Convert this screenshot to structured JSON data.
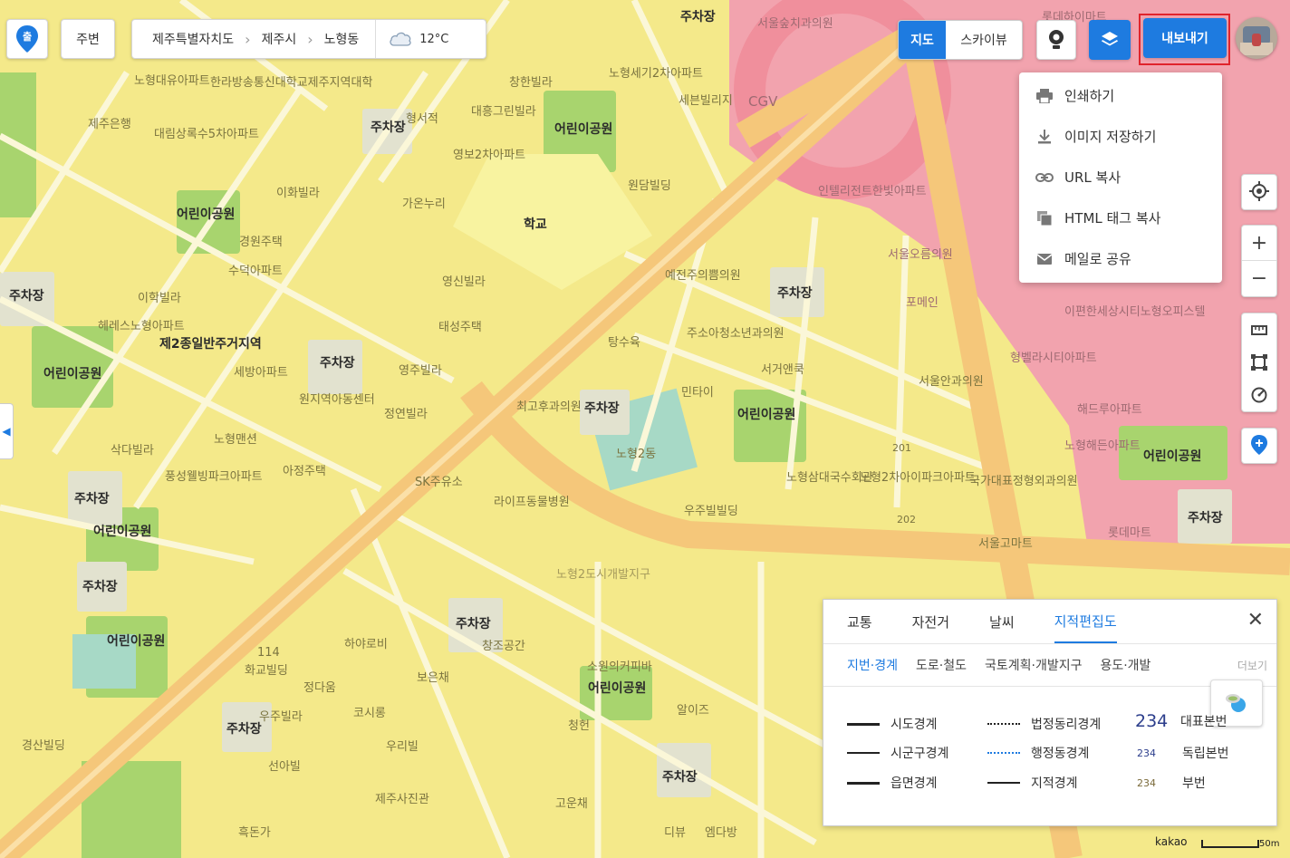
{
  "topbar": {
    "logo_icon": "kakao-map-pin-icon",
    "nearby_label": "주변",
    "breadcrumb": [
      "제주특별자치도",
      "제주시",
      "노형동"
    ],
    "weather_icon": "cloud-icon",
    "temperature": "12°C",
    "map_type": {
      "map_label": "지도",
      "skyview_label": "스카이뷰",
      "active": "지도"
    },
    "roadview_icon": "roadview-icon",
    "layers_icon": "layers-icon",
    "export_label": "내보내기",
    "avatar": "user-avatar"
  },
  "export_menu": [
    {
      "icon": "print-icon",
      "label": "인쇄하기"
    },
    {
      "icon": "download-icon",
      "label": "이미지 저장하기"
    },
    {
      "icon": "link-icon",
      "label": "URL 복사"
    },
    {
      "icon": "copy-icon",
      "label": "HTML 태그 복사"
    },
    {
      "icon": "mail-icon",
      "label": "메일로 공유"
    }
  ],
  "map_labels": {
    "parking": "주차장",
    "playground": "어린이공원",
    "school": "학교",
    "zone": "제2종일반주거지역",
    "cgv": "CGV",
    "places": [
      "노형대유아파트",
      "제주은행",
      "대림상록수5차아파트",
      "한라방송통신대학교제주지역대학",
      "창한빌라",
      "노형세기2차아파트",
      "세븐빌리지",
      "서울숲치과의원",
      "롯데하이마트",
      "인텔리전트한빛아파트",
      "원담빌딩",
      "예전주의쁨의원",
      "주소아청소년과의원",
      "서거앤쿡",
      "민타이",
      "탕수육",
      "최고후과의원",
      "서울오름의원",
      "포메인",
      "이편한세상시티노형오피스텔",
      "형벨라시티아파트",
      "해드루아파트",
      "노형해든아파트",
      "서울안과의원",
      "롯데마트",
      "국가대표정형외과의원",
      "서울고마트",
      "노형삼대국수회관",
      "노형2차아이파크아파트",
      "우주빌빌딩",
      "어린이공원",
      "SK주유소",
      "라이프동물병원",
      "노형2도시개발지구",
      "창조공간",
      "보은채",
      "소원의커피바",
      "알이즈",
      "청헌",
      "고운채",
      "디뷰",
      "엠다방",
      "제주사진관",
      "코시롱",
      "우리빌",
      "정다움",
      "화교빌딩",
      "하야로비",
      "114",
      "우주빌라",
      "경원주택",
      "수덕아파트",
      "이화빌라",
      "세방아파트",
      "삭다빌라",
      "노형맨션",
      "아정주택",
      "풍성웰빙파크아파트",
      "정연빌라",
      "원지역아동센터",
      "영주빌라",
      "태성주택",
      "영신빌라",
      "가온누리",
      "형서적",
      "대흥그린빌라",
      "영보2차아파트",
      "헤레스노형아파트",
      "이학빌라",
      "경산빌딩",
      "흑돈가",
      "선아빌",
      "노형2동",
      "대유아파트"
    ],
    "numbers": [
      "201",
      "202"
    ]
  },
  "map_controls": {
    "current_location_icon": "target-icon",
    "zoom_in_icon": "plus-icon",
    "zoom_out_icon": "minus-icon",
    "ruler_icon": "ruler-icon",
    "area_icon": "area-icon",
    "radius_icon": "radius-icon",
    "add_place_icon": "add-pin-icon",
    "collapse_icon": "chevron-left-icon"
  },
  "panel": {
    "tabs": [
      "교통",
      "자전거",
      "날씨",
      "지적편집도"
    ],
    "active_tab": "지적편집도",
    "close_icon": "close-icon",
    "subtabs": [
      "지번·경계",
      "도로·철도",
      "국토계획·개발지구",
      "용도·개발"
    ],
    "more_label": "더보기",
    "legend": [
      {
        "label": "시도경계"
      },
      {
        "label": "시군구경계"
      },
      {
        "label": "읍면경계"
      },
      {
        "label": "법정동리경계"
      },
      {
        "label": "행정동경계"
      },
      {
        "label": "지적경계"
      },
      {
        "num": "234",
        "label": "대표본번"
      },
      {
        "num": "234",
        "label": "독립본번"
      },
      {
        "num": "234",
        "label": "부번"
      }
    ]
  },
  "scale": {
    "brand": "kakao",
    "distance": "50m"
  },
  "colors": {
    "accent": "#1e7be0",
    "export_outline": "#e0242c",
    "residential": "#f4e98a",
    "commercial": "#f2a3ae",
    "road": "#f5c77a"
  }
}
